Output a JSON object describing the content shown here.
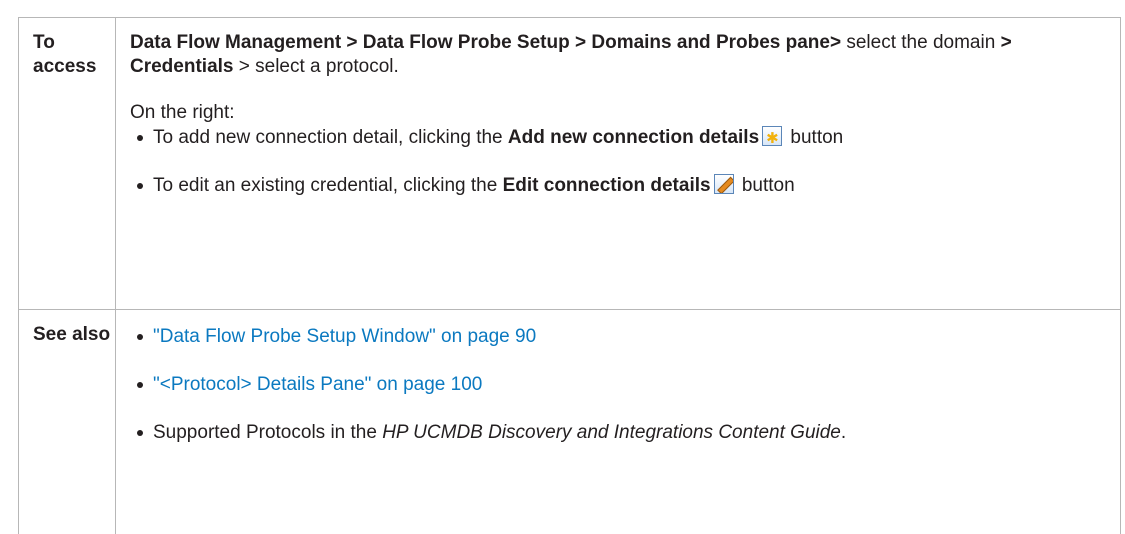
{
  "table": {
    "rows": [
      {
        "label": "To access",
        "path": {
          "part1": "Data Flow Management > Data Flow Probe Setup > Domains and Probes pane>",
          "part2": " select the domain ",
          "part3": "> Credentials",
          "part4": " > select a protocol."
        },
        "on_right": "On the right:",
        "items": [
          {
            "prefix": "To add new connection detail, clicking the ",
            "bold": "Add new connection details",
            "icon": "add-new-icon",
            "suffix": " button"
          },
          {
            "prefix": "To edit an existing credential, clicking the ",
            "bold": "Edit connection details",
            "icon": "edit-pencil-icon",
            "suffix": " button"
          }
        ]
      },
      {
        "label": "See also",
        "links": [
          "\"Data Flow Probe Setup Window\" on page 90",
          "\"<Protocol> Details Pane\" on page 100"
        ],
        "last_item": {
          "prefix": "Supported Protocols in the ",
          "italic": "HP UCMDB Discovery and Integrations Content Guide",
          "suffix": "."
        }
      }
    ]
  },
  "colors": {
    "text": "#231f20",
    "link": "#0b79c0",
    "border": "#b7b7b7"
  }
}
